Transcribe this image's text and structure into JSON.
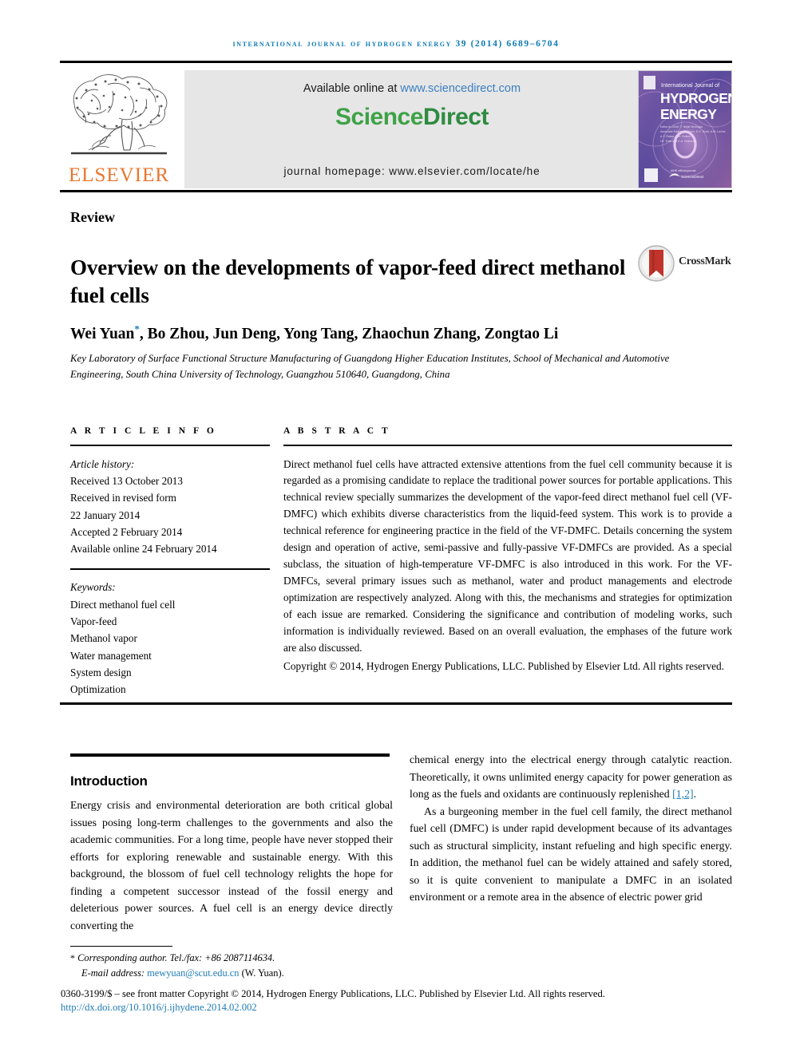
{
  "running_head": "International Journal of Hydrogen Energy 39 (2014) 6689–6704",
  "header": {
    "available_prefix": "Available online at ",
    "available_url": "www.sciencedirect.com",
    "sciencedirect_science": "Science",
    "sciencedirect_direct": "Direct",
    "journal_homepage": "journal homepage: www.elsevier.com/locate/he",
    "elsevier_wordmark": "ELSEVIER",
    "cover": {
      "line_small": "International Journal of",
      "line_1": "HYDROGEN",
      "line_2": "ENERGY",
      "editor_block": "Editor-in-Chief: T. Nejat Veziroğlu\nAssociate Editors: S. Dunn, D.S. Scott, A.M. Lovins, A.T. Raissi, L.W. Rollins, I.E. Traci and D.A. Smirnova",
      "footer_brand": "ScienceDirect"
    }
  },
  "article": {
    "type": "Review",
    "title": "Overview on the developments of vapor-feed direct methanol fuel cells",
    "crossmark_label": "CrossMark",
    "authors": "Wei Yuan, Bo Zhou, Jun Deng, Yong Tang, Zhaochun Zhang, Zongtao Li",
    "corresponding_marker": "*",
    "affiliation": "Key Laboratory of Surface Functional Structure Manufacturing of Guangdong Higher Education Institutes, School of Mechanical and Automotive Engineering, South China University of Technology, Guangzhou 510640, Guangdong, China"
  },
  "article_info": {
    "section_label": "A R T I C L E   I N F O",
    "history_label": "Article history:",
    "history": [
      "Received 13 October 2013",
      "Received in revised form",
      "22 January 2014",
      "Accepted 2 February 2014",
      "Available online 24 February 2014"
    ],
    "keywords_label": "Keywords:",
    "keywords": [
      "Direct methanol fuel cell",
      "Vapor-feed",
      "Methanol vapor",
      "Water management",
      "System design",
      "Optimization"
    ]
  },
  "abstract": {
    "section_label": "A B S T R A C T",
    "text": "Direct methanol fuel cells have attracted extensive attentions from the fuel cell community because it is regarded as a promising candidate to replace the traditional power sources for portable applications. This technical review specially summarizes the development of the vapor-feed direct methanol fuel cell (VF-DMFC) which exhibits diverse characteristics from the liquid-feed system. This work is to provide a technical reference for engineering practice in the field of the VF-DMFC. Details concerning the system design and operation of active, semi-passive and fully-passive VF-DMFCs are provided. As a special subclass, the situation of high-temperature VF-DMFC is also introduced in this work. For the VF-DMFCs, several primary issues such as methanol, water and product managements and electrode optimization are respectively analyzed. Along with this, the mechanisms and strategies for optimization of each issue are remarked. Considering the significance and contribution of modeling works, such information is individually reviewed. Based on an overall evaluation, the emphases of the future work are also discussed.",
    "copyright": "Copyright © 2014, Hydrogen Energy Publications, LLC. Published by Elsevier Ltd. All rights reserved."
  },
  "body": {
    "intro_heading": "Introduction",
    "left_paragraph": "Energy crisis and environmental deterioration are both critical global issues posing long-term challenges to the governments and also the academic communities. For a long time, people have never stopped their efforts for exploring renewable and sustainable energy. With this background, the blossom of fuel cell technology relights the hope for finding a competent successor instead of the fossil energy and deleterious power sources. A fuel cell is an energy device directly converting the",
    "right_paragraph_1_pre": "chemical energy into the electrical energy through catalytic reaction. Theoretically, it owns unlimited energy capacity for power generation as long as the fuels and oxidants are continuously replenished ",
    "right_paragraph_1_ref": "[1,2]",
    "right_paragraph_1_post": ".",
    "right_paragraph_2": "As a burgeoning member in the fuel cell family, the direct methanol fuel cell (DMFC) is under rapid development because of its advantages such as structural simplicity, instant refueling and high specific energy. In addition, the methanol fuel can be widely attained and safely stored, so it is quite convenient to manipulate a DMFC in an isolated environment or a remote area in the absence of electric power grid"
  },
  "footer": {
    "corresponding_marker": "*",
    "corresponding_text": "Corresponding author. Tel./fax: +86 2087114634.",
    "email_label": "E-mail address: ",
    "email": "mewyuan@scut.edu.cn",
    "email_suffix": " (W. Yuan).",
    "imprint": "0360-3199/$ – see front matter Copyright © 2014, Hydrogen Energy Publications, LLC. Published by Elsevier Ltd. All rights reserved.",
    "doi": "http://dx.doi.org/10.1016/j.ijhydene.2014.02.002"
  },
  "colors": {
    "journal_blue": "#0b7ab3",
    "link_blue": "#1e7bb5",
    "sciencedirect_green": "#3EA247",
    "elsevier_orange": "#E8762C",
    "band_gray": "#e6e6e6",
    "crossmark_red": "#C0342B"
  }
}
